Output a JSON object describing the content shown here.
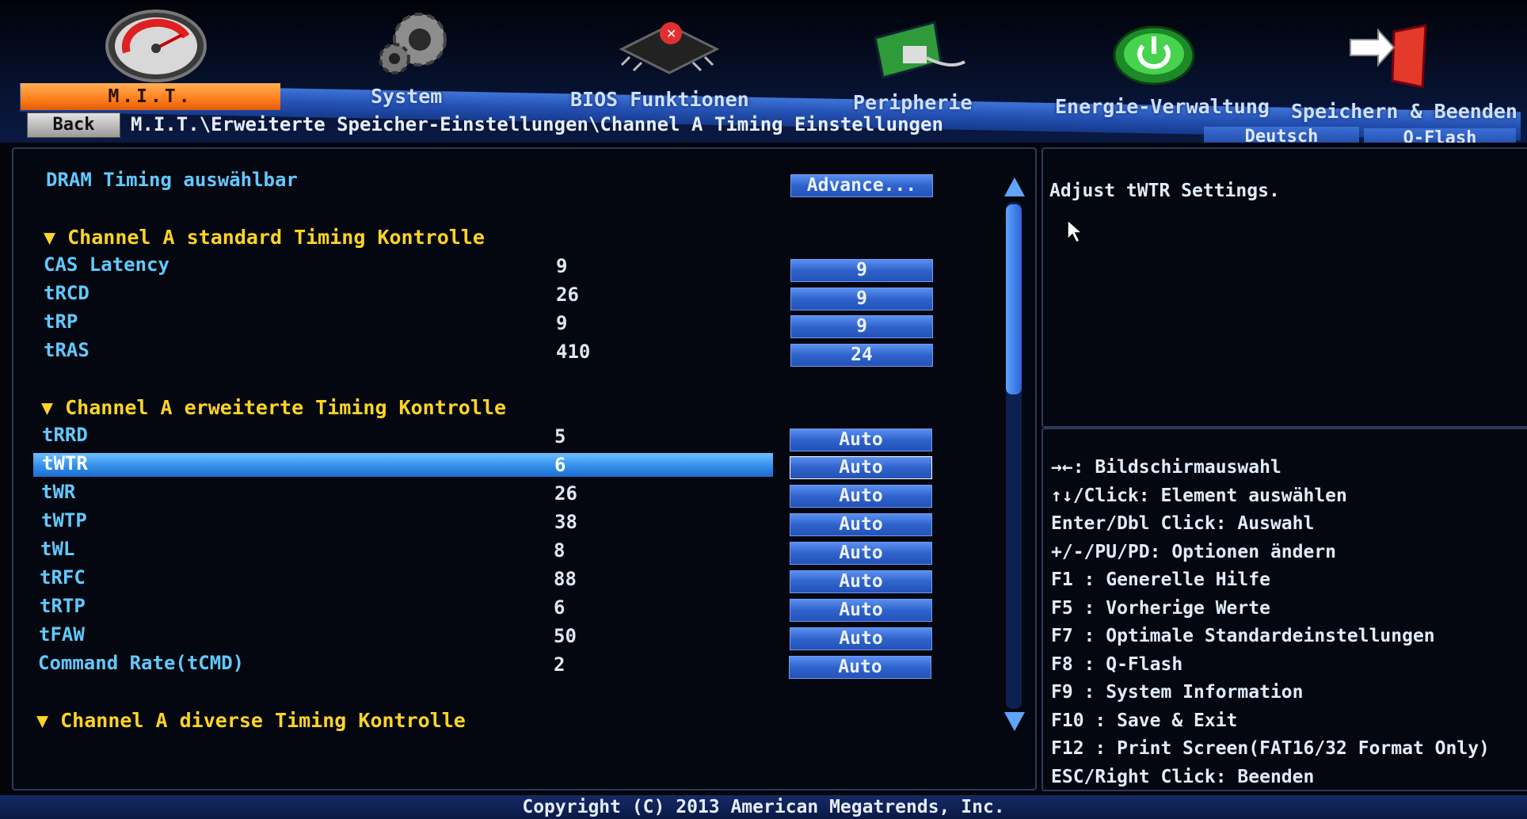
{
  "nav": {
    "tabs": [
      {
        "label": "M.I.T.",
        "icon": "speedometer-icon"
      },
      {
        "label": "System",
        "icon": "gear-icon"
      },
      {
        "label": "BIOS Funktionen",
        "icon": "chip-icon"
      },
      {
        "label": "Peripherie",
        "icon": "pci-card-icon"
      },
      {
        "label": "Energie-Verwaltung",
        "icon": "power-icon"
      },
      {
        "label": "Speichern & Beenden",
        "icon": "exit-door-icon"
      }
    ],
    "back_label": "Back",
    "breadcrumb": "M.I.T.\\Erweiterte Speicher-Einstellungen\\Channel A Timing Einstellungen",
    "language_button": "Deutsch",
    "qflash_button": "Q-Flash"
  },
  "settings": {
    "dram_timing_label": "DRAM Timing auswählbar",
    "dram_timing_value": "Advance...",
    "sections": [
      {
        "title": "Channel A standard Timing Kontrolle"
      },
      {
        "title": "Channel A erweiterte Timing Kontrolle"
      },
      {
        "title": "Channel A diverse Timing Kontrolle"
      }
    ],
    "standard_rows": [
      {
        "name": "CAS Latency",
        "current": "9",
        "setting": "9"
      },
      {
        "name": "tRCD",
        "current": "26",
        "setting": "9"
      },
      {
        "name": "tRP",
        "current": "9",
        "setting": "9"
      },
      {
        "name": "tRAS",
        "current": "410",
        "setting": "24"
      }
    ],
    "advanced_rows": [
      {
        "name": "tRRD",
        "current": "5",
        "setting": "Auto"
      },
      {
        "name": "tWTR",
        "current": "6",
        "setting": "Auto"
      },
      {
        "name": "tWR",
        "current": "26",
        "setting": "Auto"
      },
      {
        "name": "tWTP",
        "current": "38",
        "setting": "Auto"
      },
      {
        "name": "tWL",
        "current": "8",
        "setting": "Auto"
      },
      {
        "name": "tRFC",
        "current": "88",
        "setting": "Auto"
      },
      {
        "name": "tRTP",
        "current": "6",
        "setting": "Auto"
      },
      {
        "name": "tFAW",
        "current": "50",
        "setting": "Auto"
      },
      {
        "name": "Command Rate(tCMD)",
        "current": "2",
        "setting": "Auto"
      }
    ]
  },
  "help": {
    "text": "Adjust tWTR Settings."
  },
  "keys": [
    "→←: Bildschirmauswahl",
    "↑↓/Click: Element auswählen",
    "Enter/Dbl Click: Auswahl",
    "+/-/PU/PD: Optionen ändern",
    "F1  : Generelle Hilfe",
    "F5  : Vorherige Werte",
    "F7  : Optimale Standardeinstellungen",
    "F8  : Q-Flash",
    "F9  : System Information",
    "F10 : Save & Exit",
    "F12 : Print Screen(FAT16/32 Format Only)",
    "ESC/Right Click: Beenden"
  ],
  "footer": {
    "copyright": "Copyright (C) 2013 American Megatrends, Inc."
  },
  "colors": {
    "accent_orange": "#ff8a2a",
    "label_cyan": "#62c9ff",
    "section_yellow": "#ffd426",
    "button_blue": "#2f63cc"
  }
}
